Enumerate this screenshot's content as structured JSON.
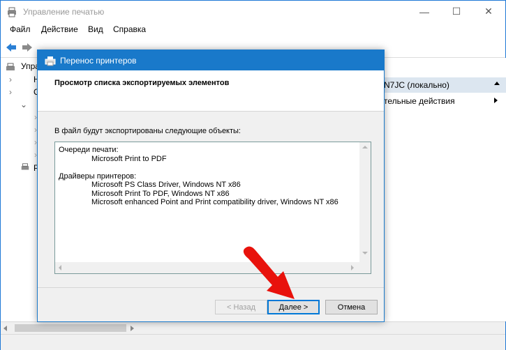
{
  "main_window": {
    "title": "Управление печатью",
    "controls": {
      "minimize": "—",
      "maximize": "☐",
      "close": "✕"
    }
  },
  "menu": [
    "Файл",
    "Действие",
    "Вид",
    "Справка"
  ],
  "tree": {
    "root_label": "Управ",
    "items": [
      "Н",
      "С",
      "",
      "",
      "",
      "",
      "Р"
    ]
  },
  "actions": {
    "header": "N7JC (локально)",
    "more": "тельные действия"
  },
  "dialog": {
    "title": "Перенос принтеров",
    "heading": "Просмотр списка экспортируемых элементов",
    "description": "В файл будут экспортированы следующие объекты:",
    "list": [
      {
        "text": "Очереди печати:",
        "indent": false
      },
      {
        "text": "Microsoft Print to PDF",
        "indent": true
      },
      {
        "text": "",
        "indent": false
      },
      {
        "text": "Драйверы принтеров:",
        "indent": false
      },
      {
        "text": "Microsoft PS Class Driver, Windows NT x86",
        "indent": true
      },
      {
        "text": "Microsoft Print To PDF, Windows NT x86",
        "indent": true
      },
      {
        "text": "Microsoft enhanced Point and Print compatibility driver, Windows NT x86",
        "indent": true
      }
    ],
    "buttons": {
      "back": "< Назад",
      "next": "Далее >",
      "cancel": "Отмена"
    }
  },
  "colors": {
    "accent": "#1979ca",
    "annotation": "#e8120c"
  }
}
